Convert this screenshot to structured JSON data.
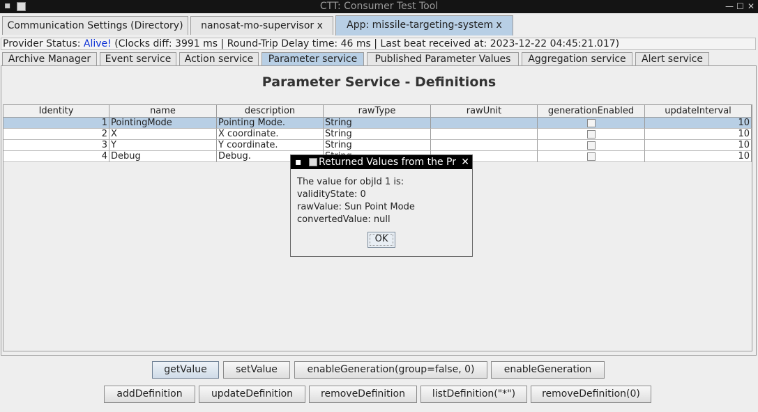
{
  "window": {
    "title": "CTT: Consumer Test Tool",
    "sys_menu": "▪",
    "minimize": "—",
    "maximize": "☐",
    "close": "✕"
  },
  "top_tabs": [
    {
      "label": "Communication Settings (Directory)"
    },
    {
      "label": "nanosat-mo-supervisor x"
    },
    {
      "label": "App: missile-targeting-system x"
    }
  ],
  "status": {
    "prefix": "Provider Status: ",
    "alive": "Alive!",
    "details": " (Clocks diff: 3991 ms | Round-Trip Delay time: 46 ms | Last beat received at: 2023-12-22 04:45:21.017)"
  },
  "service_tabs": [
    {
      "label": "Archive Manager"
    },
    {
      "label": "Event service"
    },
    {
      "label": "Action service"
    },
    {
      "label": "Parameter service"
    },
    {
      "label": "Published Parameter Values"
    },
    {
      "label": "Aggregation service"
    },
    {
      "label": "Alert service"
    }
  ],
  "panel_title": "Parameter Service - Definitions",
  "table": {
    "columns": [
      "Identity",
      "name",
      "description",
      "rawType",
      "rawUnit",
      "generationEnabled",
      "updateInterval"
    ],
    "rows": [
      {
        "identity": "1",
        "name": "PointingMode",
        "description": "Pointing Mode.",
        "rawType": "String",
        "rawUnit": "",
        "generationEnabled": false,
        "updateInterval": "10",
        "selected": true
      },
      {
        "identity": "2",
        "name": "X",
        "description": "X coordinate.",
        "rawType": "String",
        "rawUnit": "",
        "generationEnabled": false,
        "updateInterval": "10",
        "selected": false
      },
      {
        "identity": "3",
        "name": "Y",
        "description": "Y coordinate.",
        "rawType": "String",
        "rawUnit": "",
        "generationEnabled": false,
        "updateInterval": "10",
        "selected": false
      },
      {
        "identity": "4",
        "name": "Debug",
        "description": "Debug.",
        "rawType": "String",
        "rawUnit": "",
        "generationEnabled": false,
        "updateInterval": "10",
        "selected": false
      }
    ]
  },
  "dialog": {
    "sys_menu": "▪",
    "title": "Returned Values from the Pr",
    "close": "✕",
    "lines": [
      "The value for objId 1 is:",
      "validityState: 0",
      "rawValue: Sun Point Mode",
      "convertedValue: null"
    ],
    "ok": "OK"
  },
  "buttons_row1": [
    "getValue",
    "setValue",
    "enableGeneration(group=false, 0)",
    "enableGeneration"
  ],
  "buttons_row2": [
    "addDefinition",
    "updateDefinition",
    "removeDefinition",
    "listDefinition(\"*\")",
    "removeDefinition(0)"
  ]
}
